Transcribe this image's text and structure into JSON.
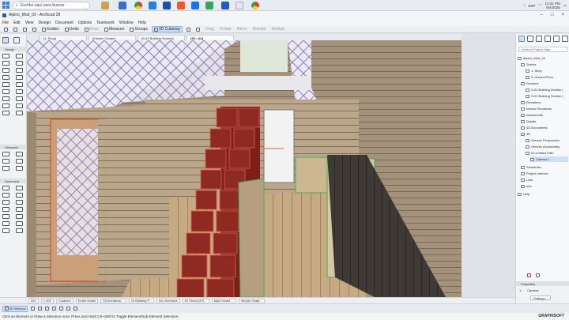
{
  "taskbar": {
    "search_placeholder": "Escribe aquí para buscar",
    "language": "ESP",
    "time": "12:01 PM",
    "date": "5/4/2026"
  },
  "window": {
    "title": "Alpino_Mod_03 - Archicad 28"
  },
  "menu": [
    "File",
    "Edit",
    "View",
    "Design",
    "Document",
    "Options",
    "Teamwork",
    "Window",
    "Help"
  ],
  "toolbar": {
    "guides": "Guides",
    "grids": "Grids",
    "move": "Move",
    "measure": "Measure",
    "groups": "Groups",
    "cutaway": "3D Cutaway",
    "drag": "Drag",
    "rotate": "Rotate",
    "mirror": "Mirror",
    "elevate": "Elevate",
    "multiply": "Multiply"
  },
  "tabs": [
    "[1. Story]",
    "[Kitchen Center]",
    "[S-02 Building Section]",
    "[3D / All]"
  ],
  "toolbox": {
    "sections": [
      "Design",
      "Viewpoint",
      "Document"
    ]
  },
  "viewctl": {
    "view_mode": "3D Window",
    "scale": "1:100",
    "zoom": "323",
    "custom": "Custome",
    "model": "Entire Model",
    "architect": "03 Architectu...",
    "building": "03 Building P...",
    "overrides": "No Overrides",
    "show": "00 Show All E...",
    "model2": "Main Model ...",
    "shading": "Simple Shadi..."
  },
  "navigator": {
    "search_placeholder": "Search Project Map",
    "tree": [
      {
        "label": "Alpino_Mod_03",
        "level": 0
      },
      {
        "label": "Stories",
        "level": 1
      },
      {
        "label": "1. Story",
        "level": 2
      },
      {
        "label": "0. Ground Floor",
        "level": 2
      },
      {
        "label": "Sections",
        "level": 1
      },
      {
        "label": "S-01 Building Section (",
        "level": 2
      },
      {
        "label": "S-02 Building Section (",
        "level": 2
      },
      {
        "label": "Elevations",
        "level": 1
      },
      {
        "label": "Interior Elevations",
        "level": 1
      },
      {
        "label": "Worksheets",
        "level": 1
      },
      {
        "label": "Details",
        "level": 1
      },
      {
        "label": "3D Documents",
        "level": 1
      },
      {
        "label": "3D",
        "level": 1
      },
      {
        "label": "Generic Perspective",
        "level": 2
      },
      {
        "label": "Generic Axonometry",
        "level": 2
      },
      {
        "label": "00 Untitled Path",
        "level": 2
      },
      {
        "label": "Camera 1",
        "level": 3,
        "selected": true
      },
      {
        "label": "Schedules",
        "level": 1
      },
      {
        "label": "Project Indexes",
        "level": 1
      },
      {
        "label": "Lists",
        "level": 1
      },
      {
        "label": "Info",
        "level": 1
      },
      {
        "label": "Help",
        "level": 0
      }
    ],
    "properties_title": "Properties",
    "prop_index": "1",
    "prop_value": "Camera",
    "settings_button": "Settings..."
  },
  "status": {
    "hint": "Click an Element or Draw a Selection Area. Press and Hold Ctrl+Shift to Toggle Element/Sub-Element Selection.",
    "brand": "GRAPHISOFT"
  }
}
